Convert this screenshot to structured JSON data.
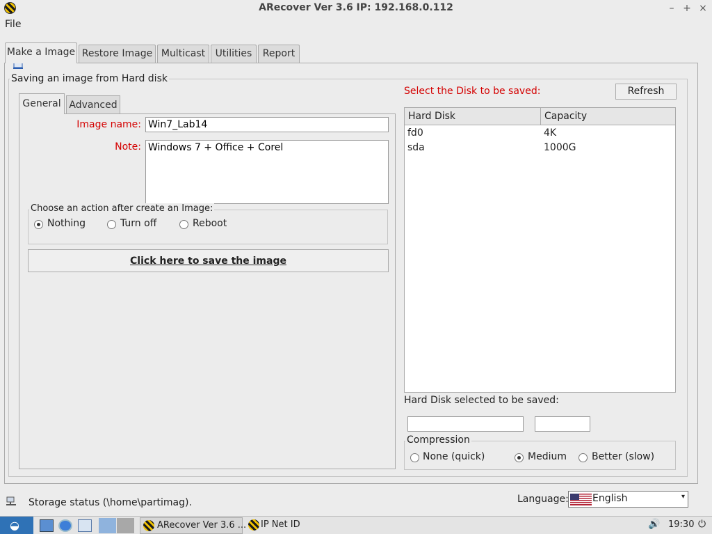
{
  "window": {
    "title": "ARecover Ver 3.6 IP: 192.168.0.112",
    "minimize": "–",
    "maximize": "+",
    "close": "×"
  },
  "menu": {
    "file": "File"
  },
  "tabs": [
    "Make a Image",
    "Restore Image",
    "Multicast",
    "Utilities",
    "Report"
  ],
  "group_title": "Saving an image from Hard disk",
  "subtabs": [
    "General",
    "Advanced"
  ],
  "form": {
    "image_name_label": "Image name:",
    "image_name_value": "Win7_Lab14",
    "note_label": "Note:",
    "note_value": "Windows 7 + Office + Corel",
    "action_group_title": "Choose an action after create an Image:",
    "actions": [
      {
        "label": "Nothing",
        "checked": true
      },
      {
        "label": "Turn off",
        "checked": false
      },
      {
        "label": "Reboot",
        "checked": false
      }
    ],
    "save_button": "Click here to save the image"
  },
  "disk": {
    "select_label": "Select the Disk to be saved:",
    "refresh_button": "Refresh",
    "columns": [
      "Hard Disk",
      "Capacity"
    ],
    "rows": [
      {
        "disk": "fd0",
        "capacity": "4K"
      },
      {
        "disk": "sda",
        "capacity": "1000G"
      }
    ],
    "selected_label": "Hard Disk selected to be saved:",
    "selected_disk": "",
    "selected_capacity": ""
  },
  "compression": {
    "title": "Compression",
    "options": [
      {
        "label": "None (quick)",
        "checked": false
      },
      {
        "label": "Medium",
        "checked": true
      },
      {
        "label": "Better (slow)",
        "checked": false
      }
    ]
  },
  "status": {
    "text": "Storage status (\\home\\partimag)."
  },
  "language": {
    "label": "Language:",
    "value": "English"
  },
  "taskbar": {
    "task1": "ARecover Ver 3.6 ...",
    "task2": "IP Net ID",
    "clock": "19:30"
  },
  "colors": {
    "accent_red": "#d40000",
    "background": "#ececec"
  }
}
